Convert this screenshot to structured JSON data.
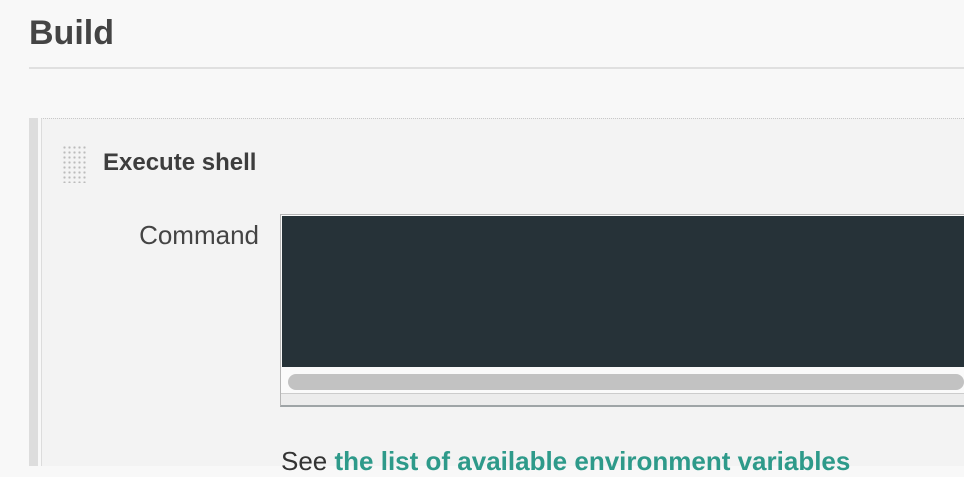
{
  "section": {
    "title": "Build"
  },
  "step": {
    "title": "Execute shell",
    "command_label": "Command",
    "command_value": "",
    "help_prefix": "See ",
    "help_link": "the list of available environment variables"
  },
  "colors": {
    "editor_bg": "#263238",
    "link": "#2e9a8a"
  }
}
